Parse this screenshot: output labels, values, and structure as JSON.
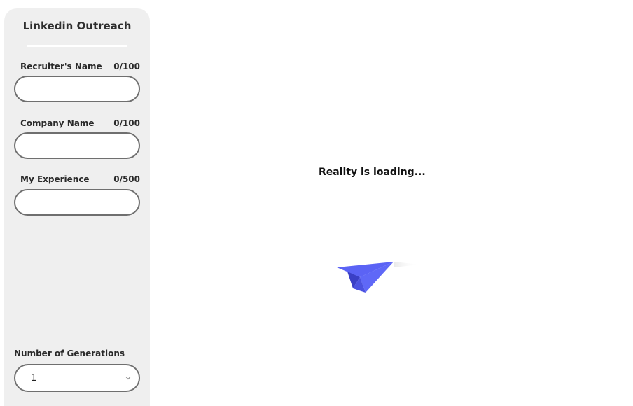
{
  "sidebar": {
    "title": "Linkedin Outreach",
    "fields": [
      {
        "label": "Recruiter's Name",
        "count": "0/100",
        "value": "",
        "placeholder": ""
      },
      {
        "label": "Company Name",
        "count": "0/100",
        "value": "",
        "placeholder": ""
      },
      {
        "label": "My Experience",
        "count": "0/500",
        "value": "",
        "placeholder": ""
      }
    ],
    "generations": {
      "label": "Number of Generations",
      "selected": "1"
    }
  },
  "main": {
    "loading_text": "Reality is loading..."
  },
  "colors": {
    "sidebar_bg": "#efefef",
    "input_border": "#6f6f6f",
    "plane_primary": "#5b63f5",
    "plane_shadow": "#3a3fc6"
  },
  "icons": {
    "plane": "paper-plane-icon",
    "select": "chevron-down-icon"
  }
}
